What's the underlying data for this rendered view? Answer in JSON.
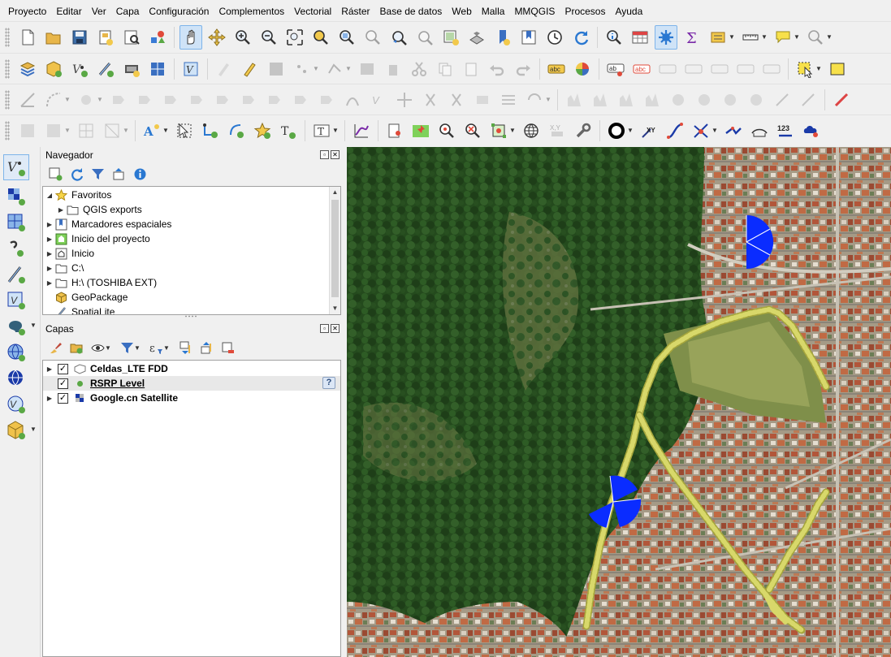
{
  "menu": [
    "Proyecto",
    "Editar",
    "Ver",
    "Capa",
    "Configuración",
    "Complementos",
    "Vectorial",
    "Ráster",
    "Base de datos",
    "Web",
    "Malla",
    "MMQGIS",
    "Procesos",
    "Ayuda"
  ],
  "navigator": {
    "title": "Navegador",
    "items": [
      {
        "label": "Favoritos",
        "icon": "star-icon",
        "expanded": true,
        "indent": 0
      },
      {
        "label": "QGIS exports",
        "icon": "folder-icon",
        "expanded": false,
        "indent": 1
      },
      {
        "label": "Marcadores espaciales",
        "icon": "bookmarks-icon",
        "expanded": false,
        "indent": 0
      },
      {
        "label": "Inicio del proyecto",
        "icon": "project-home-icon",
        "expanded": false,
        "indent": 0
      },
      {
        "label": "Inicio",
        "icon": "home-folder-icon",
        "expanded": false,
        "indent": 0
      },
      {
        "label": "C:\\",
        "icon": "drive-icon",
        "expanded": false,
        "indent": 0
      },
      {
        "label": "H:\\ (TOSHIBA EXT)",
        "icon": "drive-icon",
        "expanded": false,
        "indent": 0
      },
      {
        "label": "GeoPackage",
        "icon": "geopackage-icon",
        "expanded": null,
        "indent": 0
      },
      {
        "label": "SpatiaLite",
        "icon": "spatialite-icon",
        "expanded": null,
        "indent": 0
      }
    ]
  },
  "layers": {
    "title": "Capas",
    "items": [
      {
        "label": "Celdas_LTE FDD",
        "icon": "polygon-layer-icon",
        "checked": true,
        "expandable": true,
        "selected": false,
        "underline": false
      },
      {
        "label": "RSRP Level",
        "icon": "point-layer-icon",
        "checked": true,
        "expandable": false,
        "selected": true,
        "underline": true,
        "warning": "?"
      },
      {
        "label": "Google.cn Satellite",
        "icon": "raster-layer-icon",
        "checked": true,
        "expandable": true,
        "selected": false,
        "underline": false
      }
    ]
  },
  "colors": {
    "accent": "#0a2cff",
    "track": "#d8d86a",
    "track_dark": "#a6a63c",
    "selection": "#cfe3f7"
  }
}
